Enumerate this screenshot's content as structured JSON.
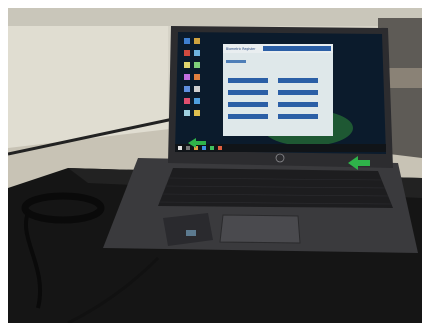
{
  "scene": {
    "subject": "laptop-on-desk",
    "screen_app": {
      "title": "Biometric Register",
      "buttons": [
        {
          "icon": "blue-button"
        },
        {
          "icon": "blue-button"
        },
        {
          "icon": "blue-button"
        },
        {
          "icon": "blue-button"
        },
        {
          "icon": "blue-button"
        },
        {
          "icon": "blue-button"
        },
        {
          "icon": "blue-button"
        },
        {
          "icon": "blue-button"
        }
      ]
    },
    "colors": {
      "wall": "#d9d6c9",
      "desk": "#161616",
      "laptop_body": "#3a3a3d",
      "screen_bg": "#0b1b2c",
      "app_window": "#dfe8ea",
      "app_button": "#2b5fa6",
      "accent_green": "#2f8a3a"
    }
  }
}
